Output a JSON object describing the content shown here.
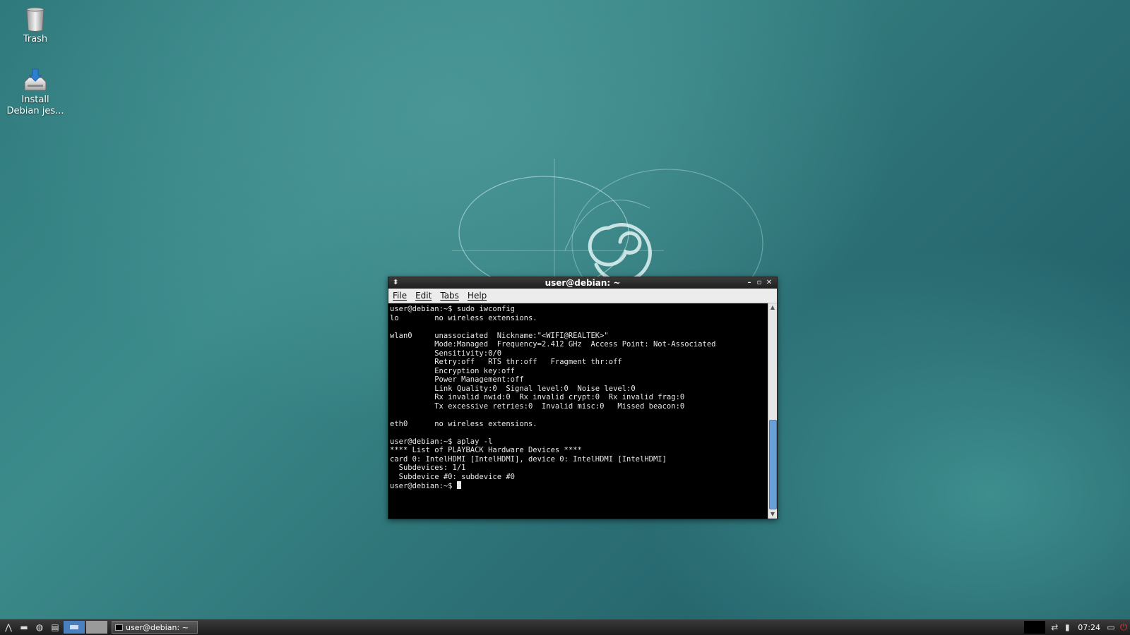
{
  "desktop": {
    "icons": [
      {
        "label": "Trash",
        "icon": "trash-icon"
      },
      {
        "label": "Install\nDebian jes...",
        "icon": "install-icon"
      }
    ]
  },
  "terminal": {
    "title": "user@debian: ~",
    "menu": [
      "File",
      "Edit",
      "Tabs",
      "Help"
    ],
    "output": "user@debian:~$ sudo iwconfig\nlo        no wireless extensions.\n\nwlan0     unassociated  Nickname:\"<WIFI@REALTEK>\"\n          Mode:Managed  Frequency=2.412 GHz  Access Point: Not-Associated\n          Sensitivity:0/0\n          Retry:off   RTS thr:off   Fragment thr:off\n          Encryption key:off\n          Power Management:off\n          Link Quality:0  Signal level:0  Noise level:0\n          Rx invalid nwid:0  Rx invalid crypt:0  Rx invalid frag:0\n          Tx excessive retries:0  Invalid misc:0   Missed beacon:0\n\neth0      no wireless extensions.\n\nuser@debian:~$ aplay -l\n**** List of PLAYBACK Hardware Devices ****\ncard 0: IntelHDMI [IntelHDMI], device 0: IntelHDMI [IntelHDMI]\n  Subdevices: 1/1\n  Subdevice #0: subdevice #0\nuser@debian:~$ ",
    "colors": {
      "background": "#000000",
      "foreground": "#e8e8e8"
    }
  },
  "taskbar": {
    "task_label": "user@debian: ~",
    "clock": "07:24",
    "colors": {
      "active_workspace": "#4a7fc0",
      "power": "#e33333"
    }
  }
}
